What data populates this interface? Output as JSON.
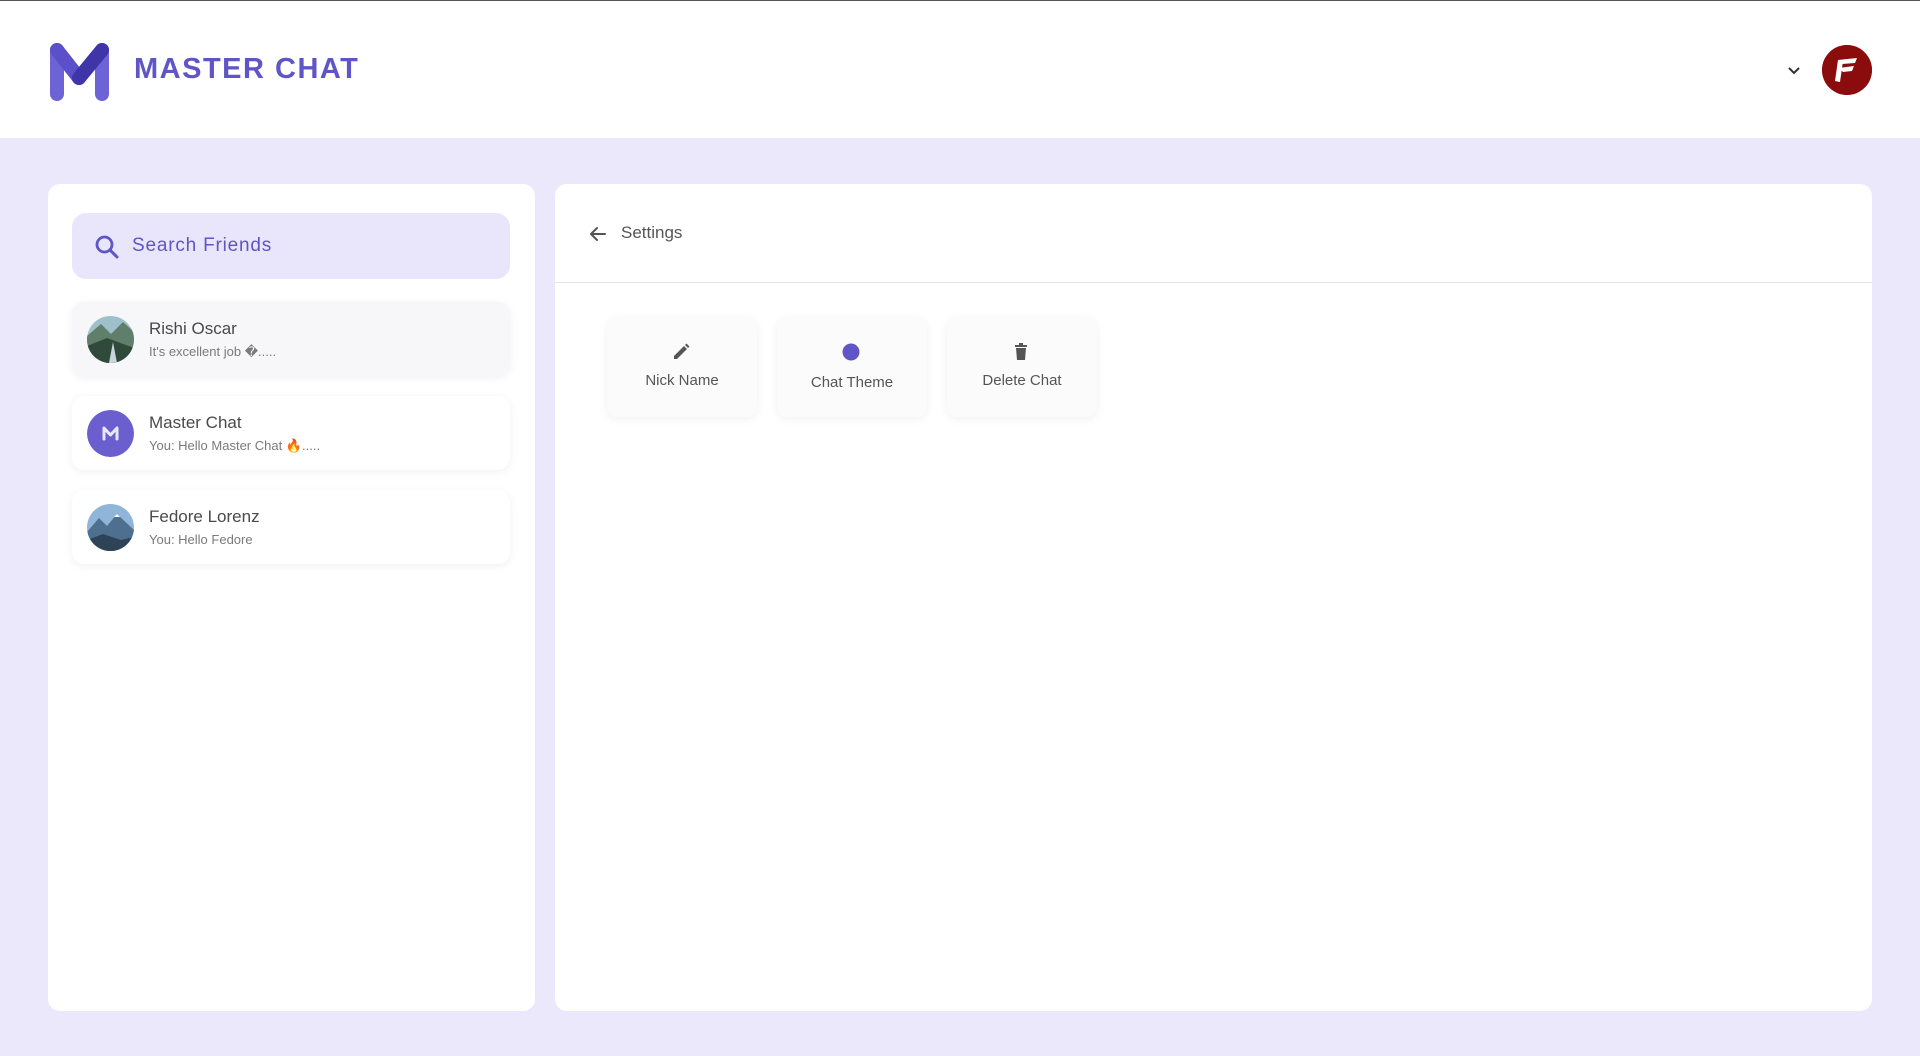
{
  "app": {
    "brand": "MASTER CHAT",
    "accent_color": "#5f55c6",
    "user_avatar_color": "#8b0c0c"
  },
  "search": {
    "placeholder": "Search Friends"
  },
  "chats": [
    {
      "name": "Rishi Oscar",
      "preview": "It's excellent job �.....",
      "avatar": "landscape-photo"
    },
    {
      "name": "Master Chat",
      "preview": "You: Hello Master Chat 🔥.....",
      "avatar": "m-logo"
    },
    {
      "name": "Fedore Lorenz",
      "preview": "You: Hello Fedore",
      "avatar": "mountain-photo"
    }
  ],
  "settings": {
    "title": "Settings",
    "cards": [
      {
        "label": "Nick Name",
        "icon": "pencil-icon"
      },
      {
        "label": "Chat Theme",
        "icon": "circle-icon"
      },
      {
        "label": "Delete Chat",
        "icon": "trash-icon"
      }
    ]
  }
}
